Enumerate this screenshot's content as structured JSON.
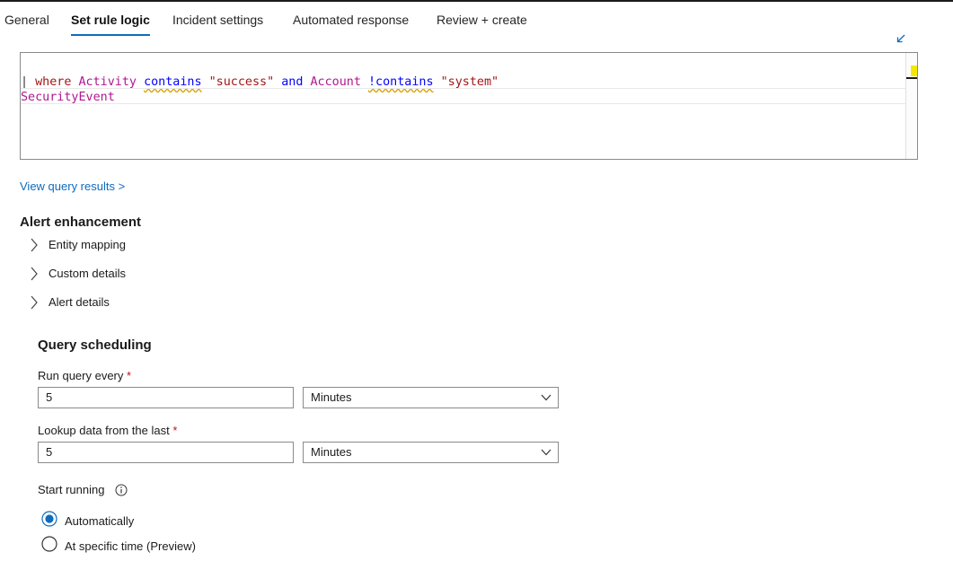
{
  "tabs": [
    {
      "label": "General",
      "active": false
    },
    {
      "label": "Set rule logic",
      "active": true
    },
    {
      "label": "Incident settings",
      "active": false
    },
    {
      "label": "Automated response",
      "active": false
    },
    {
      "label": "Review + create",
      "active": false
    }
  ],
  "editor": {
    "line1": "SecurityEvent",
    "line2": {
      "pipe": "| ",
      "where": "where",
      "col1": "Activity",
      "op1": "contains",
      "str1": "\"success\"",
      "and": "and",
      "col2": "Account",
      "op2": "!contains",
      "str2": "\"system\""
    }
  },
  "view_results_link": "View query results >",
  "alert_enhancement": {
    "title": "Alert enhancement",
    "items": [
      "Entity mapping",
      "Custom details",
      "Alert details"
    ]
  },
  "query_scheduling": {
    "title": "Query scheduling",
    "run_every": {
      "label": "Run query every",
      "required": "*",
      "value": "5",
      "unit": "Minutes"
    },
    "lookup": {
      "label": "Lookup data from the last",
      "required": "*",
      "value": "5",
      "unit": "Minutes"
    },
    "start_running": {
      "label": "Start running",
      "options": [
        {
          "label": "Automatically",
          "selected": true
        },
        {
          "label": "At specific time (Preview)",
          "selected": false
        }
      ]
    }
  },
  "colors": {
    "accent": "#0f6cbd",
    "required": "#c50f1f"
  },
  "icons": [
    "collapse-editor-icon",
    "chevron-right-icon",
    "chevron-down-icon",
    "info-icon"
  ]
}
